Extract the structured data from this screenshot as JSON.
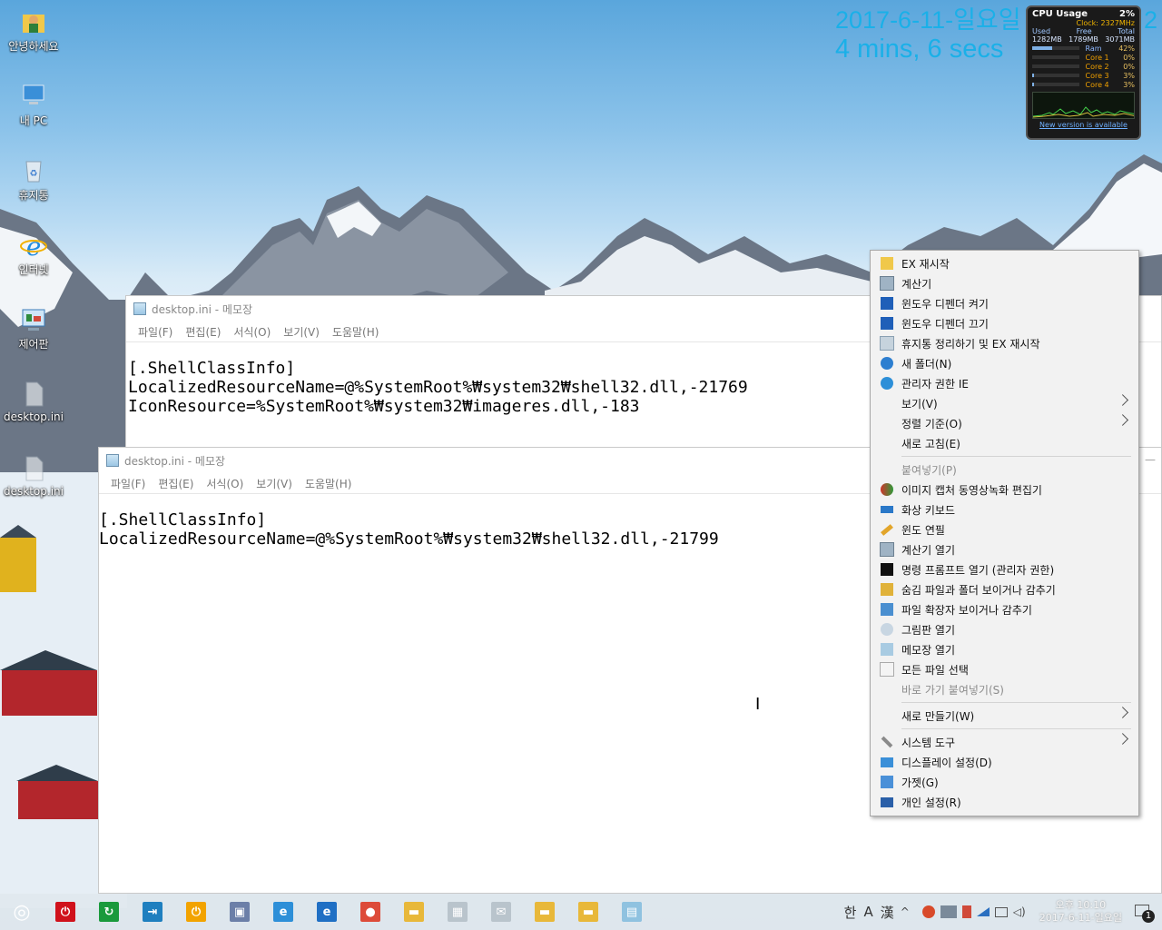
{
  "desktop": {
    "icons": [
      {
        "label": "안녕하세요",
        "icon": "user-folder-icon"
      },
      {
        "label": "내 PC",
        "icon": "computer-icon"
      },
      {
        "label": "휴지통",
        "icon": "recycle-bin-icon"
      },
      {
        "label": "인터넷",
        "icon": "internet-explorer-icon"
      },
      {
        "label": "제어판",
        "icon": "control-panel-icon"
      },
      {
        "label": "desktop.ini",
        "icon": "file-icon"
      },
      {
        "label": "desktop.ini",
        "icon": "file-icon"
      }
    ]
  },
  "clock_gadget": {
    "date": "2017-6-11-일요일",
    "uptime": "4 mins, 6 secs",
    "edge_char": "2"
  },
  "cpu_gadget": {
    "title": "CPU Usage",
    "percent": "2%",
    "clock": "Clock: 2327MHz",
    "mem_headers": [
      "Used",
      "Free",
      "Total"
    ],
    "mem_values": [
      "1282MB",
      "1789MB",
      "3071MB"
    ],
    "rows": [
      {
        "label": "Ram",
        "value": "42%",
        "fill": 0.42
      },
      {
        "label": "Core 1",
        "value": "0%",
        "fill": 0.0
      },
      {
        "label": "Core 2",
        "value": "0%",
        "fill": 0.0
      },
      {
        "label": "Core 3",
        "value": "3%",
        "fill": 0.03
      },
      {
        "label": "Core 4",
        "value": "3%",
        "fill": 0.03
      }
    ],
    "footer": "New version is available"
  },
  "notepad_back": {
    "title": "desktop.ini - 메모장",
    "menu": [
      "파일(F)",
      "편집(E)",
      "서식(O)",
      "보기(V)",
      "도움말(H)"
    ],
    "content": "[.ShellClassInfo]\nLocalizedResourceName=@%SystemRoot%₩system32₩shell32.dll,-21769\nIconResource=%SystemRoot%₩system32₩imageres.dll,-183"
  },
  "notepad_front": {
    "title": "desktop.ini - 메모장",
    "menu": [
      "파일(F)",
      "편집(E)",
      "서식(O)",
      "보기(V)",
      "도움말(H)"
    ],
    "content": "[.ShellClassInfo]\nLocalizedResourceName=@%SystemRoot%₩system32₩shell32.dll,-21799"
  },
  "context_menu": {
    "groups": [
      [
        {
          "label": "EX 재시작",
          "icon": "folder-icon",
          "disabled": false,
          "submenu": false
        },
        {
          "label": "계산기",
          "icon": "calculator-icon",
          "disabled": false,
          "submenu": false
        },
        {
          "label": "윈도우 디펜더 켜기",
          "icon": "defender-icon",
          "disabled": false,
          "submenu": false
        },
        {
          "label": "윈도우 디펜더 끄기",
          "icon": "defender-icon",
          "disabled": false,
          "submenu": false
        },
        {
          "label": "휴지통 정리하기 및 EX 재시작",
          "icon": "recycle-bin-icon",
          "disabled": false,
          "submenu": false
        },
        {
          "label": "새 폴더(N)",
          "icon": "new-folder-icon",
          "disabled": false,
          "submenu": false
        },
        {
          "label": "관리자 권한 IE",
          "icon": "internet-explorer-icon",
          "disabled": false,
          "submenu": false
        },
        {
          "label": "보기(V)",
          "icon": "",
          "disabled": false,
          "submenu": true
        },
        {
          "label": "정렬 기준(O)",
          "icon": "",
          "disabled": false,
          "submenu": true
        },
        {
          "label": "새로 고침(E)",
          "icon": "",
          "disabled": false,
          "submenu": false
        }
      ],
      [
        {
          "label": "붙여넣기(P)",
          "icon": "",
          "disabled": true,
          "submenu": false
        },
        {
          "label": "이미지 캡처 동영상녹화 편집기",
          "icon": "capture-icon",
          "disabled": false,
          "submenu": false
        },
        {
          "label": "화상 키보드",
          "icon": "keyboard-icon",
          "disabled": false,
          "submenu": false
        },
        {
          "label": "윈도 연필",
          "icon": "pencil-icon",
          "disabled": false,
          "submenu": false
        },
        {
          "label": "계산기 열기",
          "icon": "calculator-icon",
          "disabled": false,
          "submenu": false
        },
        {
          "label": "명령 프롬프트 열기 (관리자 권한)",
          "icon": "cmd-icon",
          "disabled": false,
          "submenu": false
        },
        {
          "label": "숨김 파일과 폴더 보이거나 감추기",
          "icon": "hidden-files-icon",
          "disabled": false,
          "submenu": false
        },
        {
          "label": "파일 확장자 보이거나 감추기",
          "icon": "file-extension-icon",
          "disabled": false,
          "submenu": false
        },
        {
          "label": "그림판 열기",
          "icon": "paint-icon",
          "disabled": false,
          "submenu": false
        },
        {
          "label": "메모장 열기",
          "icon": "notepad-icon",
          "disabled": false,
          "submenu": false
        },
        {
          "label": "모든 파일 선택",
          "icon": "select-all-icon",
          "disabled": false,
          "submenu": false
        },
        {
          "label": "바로 가기 붙여넣기(S)",
          "icon": "",
          "disabled": true,
          "submenu": false
        }
      ],
      [
        {
          "label": "새로 만들기(W)",
          "icon": "",
          "disabled": false,
          "submenu": true
        }
      ],
      [
        {
          "label": "시스템 도구",
          "icon": "tools-icon",
          "disabled": false,
          "submenu": true
        },
        {
          "label": "디스플레이 설정(D)",
          "icon": "display-icon",
          "disabled": false,
          "submenu": false
        },
        {
          "label": "가젯(G)",
          "icon": "gadget-icon",
          "disabled": false,
          "submenu": false
        },
        {
          "label": "개인 설정(R)",
          "icon": "personalize-icon",
          "disabled": false,
          "submenu": false
        }
      ]
    ]
  },
  "taskbar": {
    "apps": [
      {
        "name": "start-button",
        "glyph": "◎",
        "color": "transparent"
      },
      {
        "name": "power-off-button",
        "glyph": "⏻",
        "color": "#d0111b"
      },
      {
        "name": "restart-button",
        "glyph": "↻",
        "color": "#1a9a3c"
      },
      {
        "name": "logoff-button",
        "glyph": "⇥",
        "color": "#1e7fbf"
      },
      {
        "name": "sleep-button",
        "glyph": "⏻",
        "color": "#f2a300"
      },
      {
        "name": "pc-app",
        "glyph": "▣",
        "color": "#6c7fa8"
      },
      {
        "name": "ie-app",
        "glyph": "e",
        "color": "#2d8fd8"
      },
      {
        "name": "edge-app",
        "glyph": "e",
        "color": "#1f6fc4"
      },
      {
        "name": "chrome-app",
        "glyph": "●",
        "color": "#dd4b39"
      },
      {
        "name": "explorer-app",
        "glyph": "▬",
        "color": "#e8b83a"
      },
      {
        "name": "store-app",
        "glyph": "▦",
        "color": "#b9c4cc"
      },
      {
        "name": "mail-app",
        "glyph": "✉",
        "color": "#b9c4cc"
      },
      {
        "name": "folder-app-1",
        "glyph": "▬",
        "color": "#e8b83a"
      },
      {
        "name": "folder-app-2",
        "glyph": "▬",
        "color": "#e8b83a"
      },
      {
        "name": "notepad-app",
        "glyph": "▤",
        "color": "#8fc2e0"
      }
    ],
    "ime": [
      "한",
      "A",
      "漢"
    ],
    "clock_time": "오후 10:10",
    "clock_date": "2017-6-11-일요일",
    "notification_count": "1"
  }
}
